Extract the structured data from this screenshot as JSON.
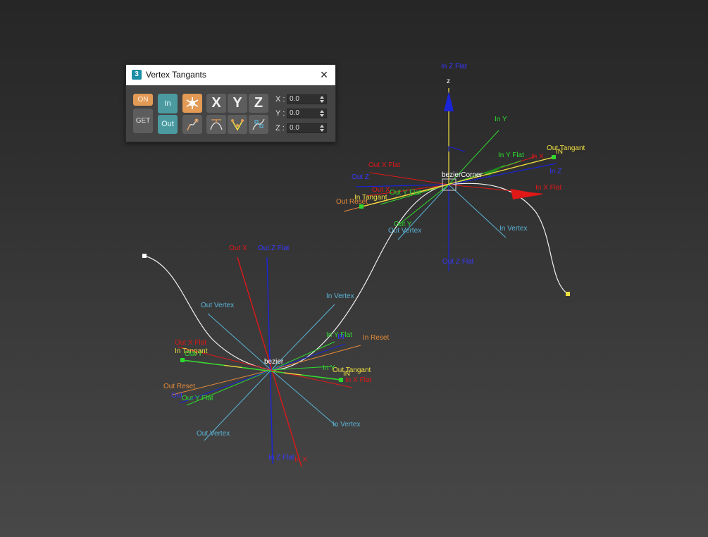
{
  "panel": {
    "logo": "3",
    "title": "Vertex Tangants",
    "close_icon": "close-icon",
    "buttons": {
      "on": "ON",
      "get": "GET",
      "in": "In",
      "out": "Out",
      "x": "X",
      "y": "Y",
      "z": "Z"
    },
    "icons": [
      "snowflake-icon",
      "curve-reset-icon",
      "flat-x-icon",
      "flat-y-icon",
      "flat-z-icon"
    ],
    "coords": [
      {
        "label": "X :",
        "value": "0.0"
      },
      {
        "label": "Y :",
        "value": "0.0"
      },
      {
        "label": "Z :",
        "value": "0.0"
      }
    ],
    "colors": {
      "accent_orange": "#e39a55",
      "accent_teal": "#4a9aa0",
      "button": "#5d5d5d"
    }
  },
  "scene": {
    "objects": [
      "bezierCorner",
      "bezier"
    ],
    "colors": {
      "x": "#e01818",
      "y": "#2ed82e",
      "z": "#1a24d8",
      "vertex": "#5ab4d6",
      "reset": "#e68a3a",
      "tangent": "#f0e040",
      "spline": "#f2f2f2"
    },
    "labels": {
      "corner_axis_z": "z",
      "corner_in_z_flat": "In Z Flat",
      "corner_in_y": "In Y",
      "corner_in_y_flat": "In Y Flat",
      "corner_in_x": "In X",
      "corner_in_badge": "IN",
      "corner_out_tangant": "Out Tangant",
      "corner_out_x_flat": "Out X Flat",
      "corner_out_z": "Out Z",
      "corner_in_z": "In Z",
      "corner_out_x": "Out X",
      "corner_out_y_flat": "Out Y Flat",
      "corner_in_x_flat": "In X Flat",
      "corner_in_tangant": "In Tangant",
      "corner_out_reset": "Out Reset",
      "corner_out_y": "Out Y",
      "corner_out_vertex": "Out Vertex",
      "corner_in_vertex": "In Vertex",
      "corner_out_z_flat": "Out Z Flat",
      "bezier_out_x": "Out X",
      "bezier_out_z_flat": "Out Z Flat",
      "bezier_out_vertex": "Out Vertex",
      "bezier_in_vertex_top": "In Vertex",
      "bezier_in_y_flat": "In Y Flat",
      "bezier_in_badge": "IN",
      "bezier_in_reset": "In Reset",
      "bezier_out_x_flat": "Out X Flat",
      "bezier_in_tangant": "In Tangant",
      "bezier_out_y_under": "Out Y",
      "bezier_in_y": "In Y",
      "bezier_out_tangant": "Out Tangant",
      "bezier_in_x_flat": "In X Flat",
      "bezier_in_badge2": "IN",
      "bezier_out_reset": "Out Reset",
      "bezier_out_z_short": "Out",
      "bezier_out_y_flat": "Out Y Flat",
      "bezier_out_vertex_bottom": "Out Vertex",
      "bezier_in_vertex_bottom": "In Vertex",
      "bezier_in_z_flat": "In Z Flat",
      "bezier_in_x": "In X"
    }
  }
}
